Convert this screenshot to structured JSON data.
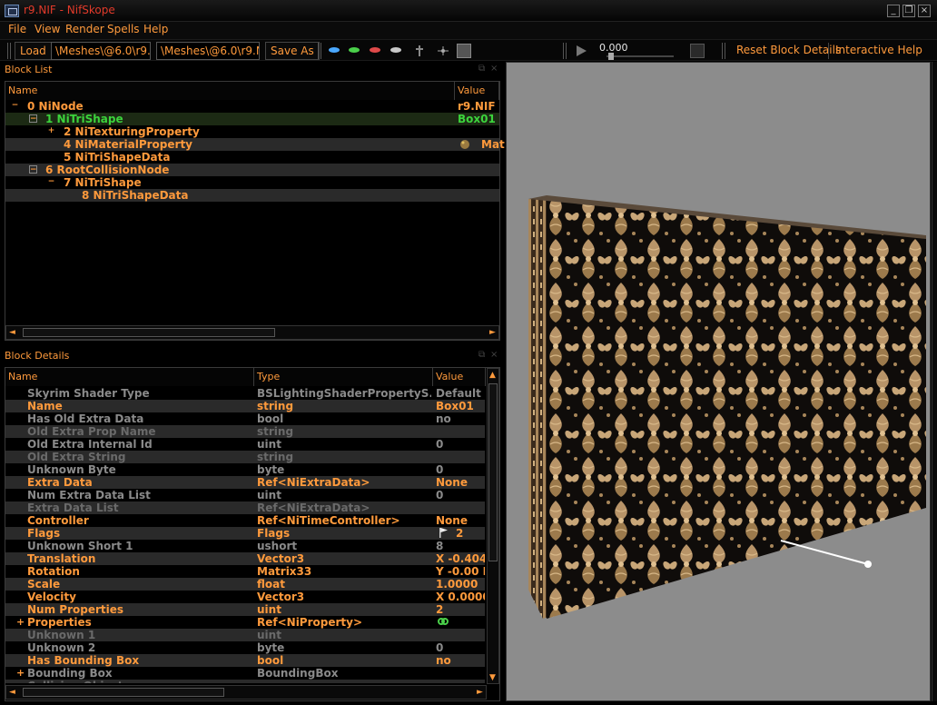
{
  "window": {
    "title": "r9.NIF - NifSkope"
  },
  "menu": {
    "items": [
      "File",
      "View",
      "Render",
      "Spells",
      "Help"
    ]
  },
  "toolbar": {
    "load_label": "Load",
    "load_path": "\\Meshes\\@6.0\\r9.NIF",
    "save_path": "\\Meshes\\@6.0\\r9.NIF",
    "save_as_label": "Save As",
    "time_value": "0.000",
    "reset_label": "Reset Block Details",
    "help_label": "Interactive Help"
  },
  "block_list": {
    "title": "Block List",
    "columns": [
      "Name",
      "Value"
    ],
    "rows": [
      {
        "text": "0 NiNode",
        "value": "r9.NIF"
      },
      {
        "text": "1 NiTriShape",
        "value": "Box01"
      },
      {
        "text": "2 NiTexturingProperty",
        "value": ""
      },
      {
        "text": "4 NiMaterialProperty",
        "value": "Mat"
      },
      {
        "text": "5 NiTriShapeData",
        "value": ""
      },
      {
        "text": "6 RootCollisionNode",
        "value": ""
      },
      {
        "text": "7 NiTriShape",
        "value": ""
      },
      {
        "text": "8 NiTriShapeData",
        "value": ""
      }
    ],
    "collapse_glyph": "−",
    "expand_glyph": "+"
  },
  "block_details": {
    "title": "Block Details",
    "columns": [
      "Name",
      "Type",
      "Value"
    ],
    "rows": [
      {
        "name": "Skyrim Shader Type",
        "type": "BSLightingShaderPropertyS...",
        "value": "Default"
      },
      {
        "name": "Name",
        "type": "string",
        "value": "Box01"
      },
      {
        "name": "Has Old Extra Data",
        "type": "bool",
        "value": "no"
      },
      {
        "name": "Old Extra Prop Name",
        "type": "string",
        "value": ""
      },
      {
        "name": "Old Extra Internal Id",
        "type": "uint",
        "value": "0"
      },
      {
        "name": "Old Extra String",
        "type": "string",
        "value": ""
      },
      {
        "name": "Unknown Byte",
        "type": "byte",
        "value": "0"
      },
      {
        "name": "Extra Data",
        "type": "Ref<NiExtraData>",
        "value": "None"
      },
      {
        "name": "Num Extra Data List",
        "type": "uint",
        "value": "0"
      },
      {
        "name": "Extra Data List",
        "type": "Ref<NiExtraData>",
        "value": ""
      },
      {
        "name": "Controller",
        "type": "Ref<NiTimeController>",
        "value": "None"
      },
      {
        "name": "Flags",
        "type": "Flags",
        "value": "2"
      },
      {
        "name": "Unknown Short 1",
        "type": "ushort",
        "value": "8"
      },
      {
        "name": "Translation",
        "type": "Vector3",
        "value": "X -0.404"
      },
      {
        "name": "Rotation",
        "type": "Matrix33",
        "value": "Y -0.00 P"
      },
      {
        "name": "Scale",
        "type": "float",
        "value": "1.0000"
      },
      {
        "name": "Velocity",
        "type": "Vector3",
        "value": "X 0.0000"
      },
      {
        "name": "Num Properties",
        "type": "uint",
        "value": "2"
      },
      {
        "name": "Properties",
        "type": "Ref<NiProperty>",
        "value": ""
      },
      {
        "name": "Unknown 1",
        "type": "uint",
        "value": ""
      },
      {
        "name": "Unknown 2",
        "type": "byte",
        "value": "0"
      },
      {
        "name": "Has Bounding Box",
        "type": "bool",
        "value": "no"
      },
      {
        "name": "Bounding Box",
        "type": "BoundingBox",
        "value": ""
      },
      {
        "name": "Collision Object",
        "type": "",
        "value": ""
      }
    ],
    "expand_glyph": "+"
  },
  "viewport": {
    "background": "#8c8c8c"
  },
  "icons": {
    "app": "nifskope-icon",
    "flag": "flag-icon",
    "link": "link-icon",
    "material": "material-icon",
    "play": "play-icon"
  },
  "window_buttons": [
    "_",
    "❐",
    "×"
  ],
  "scroll_glyphs": {
    "left": "◄",
    "right": "►",
    "up": "▲",
    "down": "▼"
  }
}
